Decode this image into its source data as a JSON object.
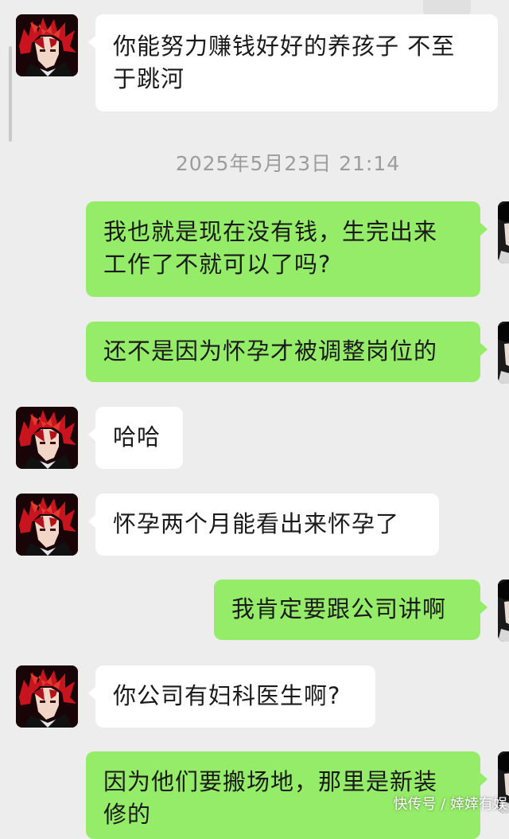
{
  "chat": {
    "timestamp": "2025年5月23日 21:14",
    "messages": [
      {
        "side": "in",
        "lines": [
          "你能努力赚钱好好的养孩子 不至",
          "于跳河"
        ]
      },
      {
        "side": "out",
        "lines": [
          "我也就是现在没有钱，生完出来",
          "工作了不就可以了吗?"
        ]
      },
      {
        "side": "out",
        "lines": [
          "还不是因为怀孕才被调整岗位的"
        ]
      },
      {
        "side": "in",
        "lines": [
          "哈哈"
        ]
      },
      {
        "side": "in",
        "lines": [
          "怀孕两个月能看出来怀孕了"
        ]
      },
      {
        "side": "out",
        "lines": [
          "我肯定要跟公司讲啊"
        ]
      },
      {
        "side": "in",
        "lines": [
          "你公司有妇科医生啊?"
        ]
      },
      {
        "side": "out",
        "lines": [
          "因为他们要搬场地，那里是新装",
          "修的"
        ]
      }
    ]
  },
  "watermark": {
    "text": "快传号 / 婞婞有娱"
  },
  "colors": {
    "background": "#ededed",
    "bubble_in": "#ffffff",
    "bubble_out": "#95ec69",
    "timestamp": "#9c9c9c"
  }
}
